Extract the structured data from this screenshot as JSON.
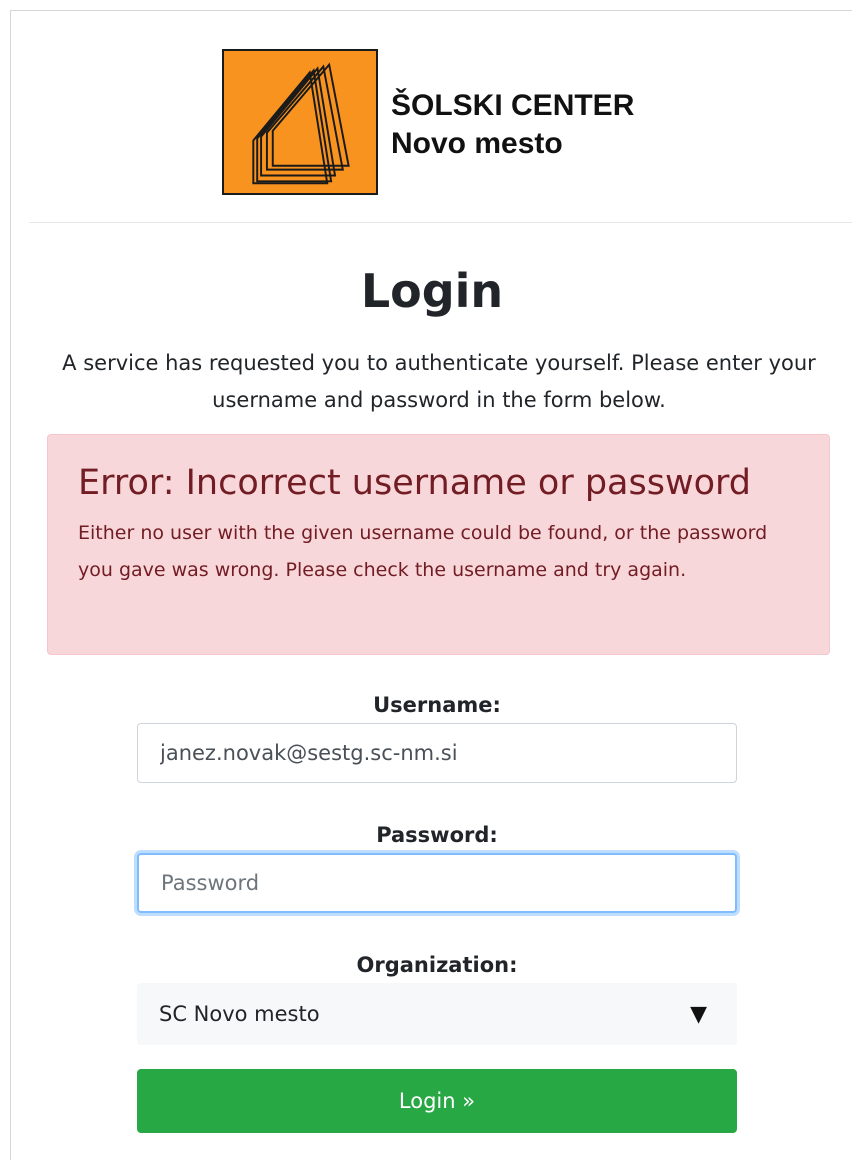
{
  "logo": {
    "line1": "ŠOLSKI CENTER",
    "line2": "Novo mesto",
    "color": "#f7931e"
  },
  "title": "Login",
  "intro": "A service has requested you to authenticate yourself. Please enter your username and password in the form below.",
  "alert": {
    "title": "Error: Incorrect username or password",
    "body": "Either no user with the given username could be found, or the password you gave was wrong. Please check the username and try again.",
    "background": "#f8d7da",
    "text_color": "#721c24"
  },
  "form": {
    "username_label": "Username:",
    "username_value": "janez.novak@sestg.sc-nm.si",
    "password_label": "Password:",
    "password_placeholder": "Password",
    "organization_label": "Organization:",
    "organization_selected": "SC Novo mesto",
    "submit_label": "Login »",
    "submit_color": "#28a745"
  }
}
